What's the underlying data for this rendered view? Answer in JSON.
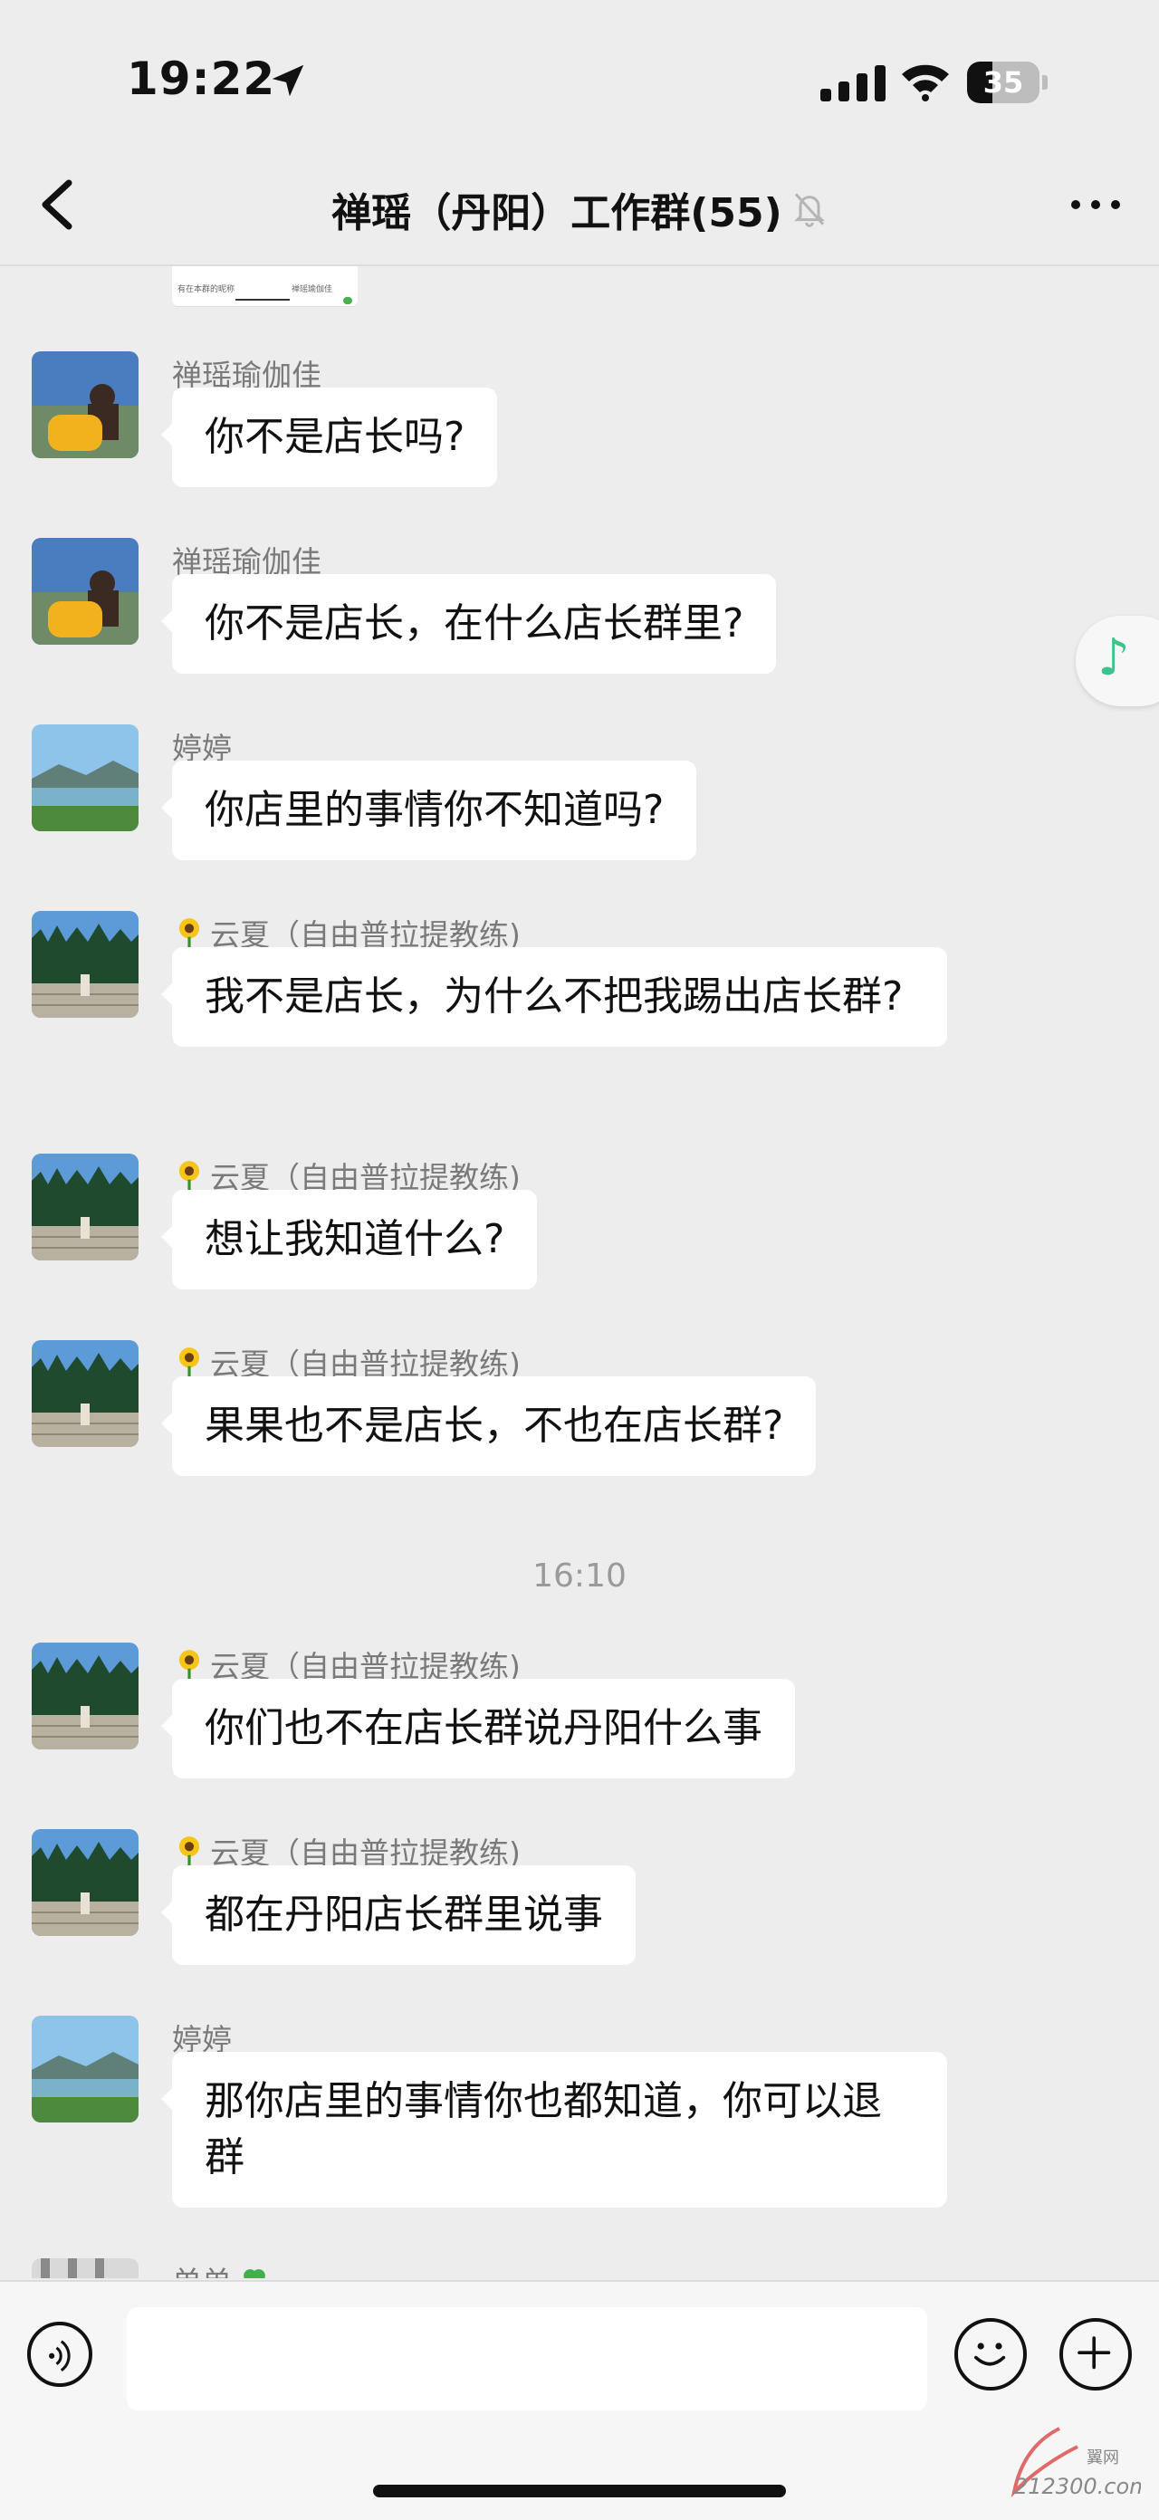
{
  "status_bar": {
    "time": "19:22",
    "battery": "35",
    "battery_level": 0.35
  },
  "nav": {
    "title": "禅瑶（丹阳）工作群(55)"
  },
  "chat": {
    "messages": [
      {
        "sender": "禅瑶瑜伽佳",
        "emoji": "",
        "avatar": "avatar-1",
        "text": "你不是店长吗?"
      },
      {
        "sender": "禅瑶瑜伽佳",
        "emoji": "",
        "avatar": "avatar-1",
        "text": "你不是店长，在什么店长群里?"
      },
      {
        "sender": "婷婷",
        "emoji": "",
        "avatar": "avatar-2",
        "text": "你店里的事情你不知道吗?"
      },
      {
        "sender": "云夏（自由普拉提教练)",
        "emoji": "sunflower",
        "avatar": "avatar-3",
        "text": "我不是店长，为什么不把我踢出店长群?"
      },
      {
        "sender": "云夏（自由普拉提教练)",
        "emoji": "sunflower",
        "avatar": "avatar-3",
        "text": "想让我知道什么?"
      },
      {
        "sender": "云夏（自由普拉提教练)",
        "emoji": "sunflower",
        "avatar": "avatar-3",
        "text": "果果也不是店长，不也在店长群?"
      },
      {
        "sender": "云夏（自由普拉提教练)",
        "emoji": "sunflower",
        "avatar": "avatar-3",
        "text": "你们也不在店长群说丹阳什么事"
      },
      {
        "sender": "云夏（自由普拉提教练)",
        "emoji": "sunflower",
        "avatar": "avatar-3",
        "text": "都在丹阳店长群里说事"
      },
      {
        "sender": "婷婷",
        "emoji": "",
        "avatar": "avatar-2",
        "text": "那你店里的事情你也都知道，你可以退群"
      },
      {
        "sender": "单单",
        "emoji": "clover",
        "avatar": "avatar-4",
        "text": ""
      }
    ],
    "timestamp": "16:10",
    "thumb_left": "有在本群的昵称",
    "thumb_right": "禅瑶瑜伽佳"
  },
  "input": {
    "placeholder": ""
  },
  "watermark": {
    "line1": "翼网",
    "line2": "212300.com"
  },
  "colors": {
    "accent_green": "#3cc48c",
    "bubble_bg": "#ffffff",
    "page_bg": "#ededed"
  }
}
